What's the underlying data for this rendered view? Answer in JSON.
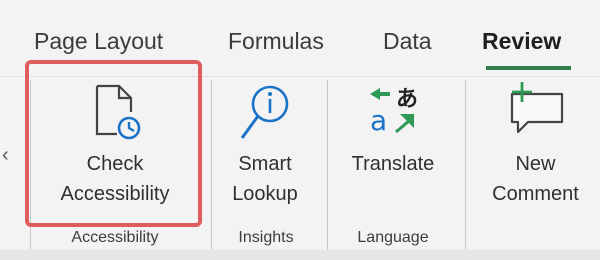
{
  "tabs": [
    {
      "label": "Page Layout"
    },
    {
      "label": "Formulas"
    },
    {
      "label": "Data"
    },
    {
      "label": "Review",
      "active": true
    }
  ],
  "colors": {
    "accent_underline": "#2e7d4a",
    "highlight_border": "#e05d5d",
    "icon_blue": "#1a73c9",
    "icon_green": "#2e9a55"
  },
  "ribbon": {
    "left_clip_glyph": "‹",
    "buttons": [
      {
        "line1": "Check",
        "line2": "Accessibility",
        "icon": "document-accessibility-icon"
      },
      {
        "line1": "Smart",
        "line2": "Lookup",
        "icon": "smart-lookup-icon"
      },
      {
        "line1": "Translate",
        "line2": "",
        "icon": "translate-icon"
      },
      {
        "line1": "New",
        "line2": "Comment",
        "icon": "new-comment-icon"
      }
    ],
    "groups": [
      {
        "label": "Accessibility"
      },
      {
        "label": "Insights"
      },
      {
        "label": "Language"
      }
    ]
  }
}
